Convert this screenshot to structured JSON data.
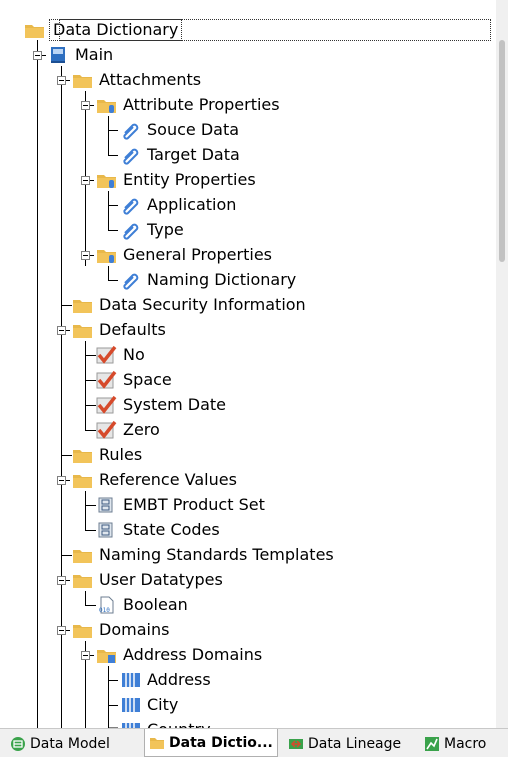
{
  "tree": {
    "root": "Data Dictionary",
    "items": [
      {
        "label": "Main",
        "icon": "book-icon"
      },
      {
        "label": "Attachments",
        "icon": "folder-icon"
      },
      {
        "label": "Attribute Properties",
        "icon": "folder-attachment-icon"
      },
      {
        "label": "Souce Data",
        "icon": "paperclip-icon"
      },
      {
        "label": "Target Data",
        "icon": "paperclip-icon"
      },
      {
        "label": "Entity Properties",
        "icon": "folder-attachment-icon"
      },
      {
        "label": "Application",
        "icon": "paperclip-icon"
      },
      {
        "label": "Type",
        "icon": "paperclip-icon"
      },
      {
        "label": "General Properties",
        "icon": "folder-attachment-icon"
      },
      {
        "label": "Naming Dictionary",
        "icon": "paperclip-icon"
      },
      {
        "label": "Data Security Information",
        "icon": "folder-icon"
      },
      {
        "label": "Defaults",
        "icon": "folder-icon"
      },
      {
        "label": "No",
        "icon": "checkmark-icon"
      },
      {
        "label": "Space",
        "icon": "checkmark-icon"
      },
      {
        "label": "System Date",
        "icon": "checkmark-icon"
      },
      {
        "label": "Zero",
        "icon": "checkmark-icon"
      },
      {
        "label": "Rules",
        "icon": "folder-icon"
      },
      {
        "label": "Reference Values",
        "icon": "folder-icon"
      },
      {
        "label": "EMBT Product Set",
        "icon": "reference-value-icon"
      },
      {
        "label": "State Codes",
        "icon": "reference-value-icon"
      },
      {
        "label": "Naming Standards Templates",
        "icon": "folder-icon"
      },
      {
        "label": "User Datatypes",
        "icon": "folder-icon"
      },
      {
        "label": "Boolean",
        "icon": "datatype-file-icon"
      },
      {
        "label": "Domains",
        "icon": "folder-icon"
      },
      {
        "label": "Address Domains",
        "icon": "folder-domain-icon"
      },
      {
        "label": "Address",
        "icon": "domain-icon"
      },
      {
        "label": "City",
        "icon": "domain-icon"
      },
      {
        "label": "Country",
        "icon": "domain-icon"
      }
    ]
  },
  "tabs": [
    {
      "label": "Data Model",
      "icon": "data-model-icon"
    },
    {
      "label": "Data Dictio...",
      "icon": "data-dictionary-icon"
    },
    {
      "label": "Data Lineage",
      "icon": "data-lineage-icon"
    },
    {
      "label": "Macro",
      "icon": "macro-icon"
    }
  ],
  "colors": {
    "folder": "#e8b84a",
    "book": "#2e6fc0",
    "check": "#d64a2b",
    "clip": "#3f7fd6",
    "tab_green": "#3aa24b"
  }
}
